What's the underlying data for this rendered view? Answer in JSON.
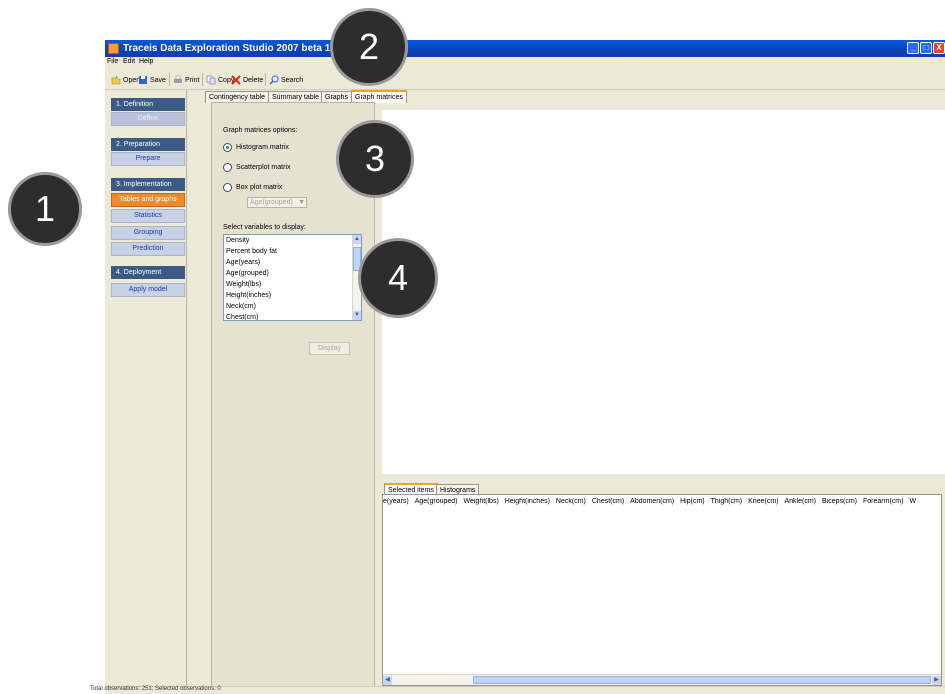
{
  "window": {
    "title": "Traceis Data Exploration Studio 2007 beta 1.1",
    "controls": [
      "_",
      "□",
      "X"
    ]
  },
  "menu": [
    "File",
    "Edit",
    "Help"
  ],
  "toolbar": {
    "open": "Open",
    "save": "Save",
    "print": "Print",
    "copy": "Copy",
    "delete": "Delete",
    "search": "Search"
  },
  "nav": {
    "sections": [
      {
        "title": "1. Definition",
        "items": [
          "Define"
        ]
      },
      {
        "title": "2. Preparation",
        "items": [
          "Prepare"
        ]
      },
      {
        "title": "3. Implementation",
        "items": [
          "Tables and graphs",
          "Statistics",
          "Grouping",
          "Prediction"
        ]
      },
      {
        "title": "4. Deployment",
        "items": [
          "Apply model"
        ]
      }
    ]
  },
  "tabs": [
    "Contingency table",
    "Summary table",
    "Graphs",
    "Graph matrices"
  ],
  "options": {
    "heading": "Graph matrices options:",
    "radios": [
      "Histogram matrix",
      "Scatterplot matrix",
      "Box plot matrix"
    ],
    "selected_radio": "Histogram matrix",
    "combo_value": "Age(grouped)",
    "variables_label": "Select variables to display:",
    "variables": [
      "Density",
      "Percent body fat",
      "Age(years)",
      "Age(grouped)",
      "Weight(lbs)",
      "Height(inches)",
      "Neck(cm)",
      "Chest(cm)"
    ],
    "display_button": "Display"
  },
  "bottom_tabs": [
    "Selected items",
    "Histograms"
  ],
  "columns": [
    "e(years)",
    "Age(grouped)",
    "Weight(lbs)",
    "Height(inches)",
    "Neck(cm)",
    "Chest(cm)",
    "Abdomen(cm)",
    "Hip(cm)",
    "Thigh(cm)",
    "Knee(cm)",
    "Ankle(cm)",
    "Biceps(cm)",
    "Forearm(cm)",
    "W"
  ],
  "status": "Total observations: 251; Selected observations: 0",
  "callouts": [
    "1",
    "2",
    "3",
    "4"
  ]
}
